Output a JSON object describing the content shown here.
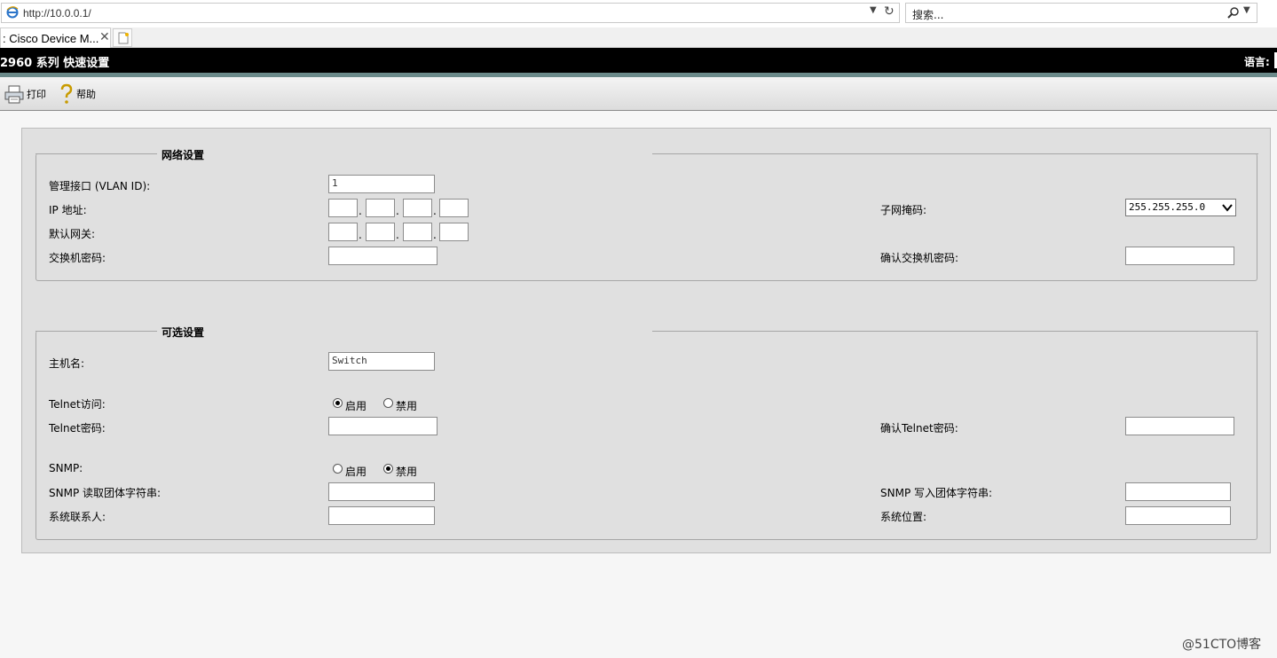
{
  "browser": {
    "address": "http://10.0.0.1/",
    "search_placeholder": "搜索...",
    "tab_title": ": Cisco Device M...",
    "tab_close": "✕"
  },
  "header": {
    "title": "2960 系列 快速设置",
    "language_label": "语言:"
  },
  "toolbar": {
    "print_label": "打印",
    "help_label": "帮助"
  },
  "network": {
    "legend": "网络设置",
    "mgmt_label": "管理接口 (VLAN ID):",
    "mgmt_value": "1",
    "ip_label": "IP 地址:",
    "subnet_label": "子网掩码:",
    "subnet_value": "255.255.255.0",
    "gateway_label": "默认网关:",
    "switch_pw_label": "交换机密码:",
    "confirm_switch_pw_label": "确认交换机密码:",
    "octet_dot": "."
  },
  "optional": {
    "legend": "可选设置",
    "hostname_label": "主机名:",
    "hostname_value": "Switch",
    "telnet_label": "Telnet访问:",
    "telnet_enable": "启用",
    "telnet_disable": "禁用",
    "telnet_pw_label": "Telnet密码:",
    "confirm_telnet_pw_label": "确认Telnet密码:",
    "snmp_label": "SNMP:",
    "snmp_enable": "启用",
    "snmp_disable": "禁用",
    "snmp_read_label": "SNMP 读取团体字符串:",
    "snmp_write_label": "SNMP 写入团体字符串:",
    "contact_label": "系统联系人:",
    "location_label": "系统位置:"
  },
  "watermark": "@51CTO博客",
  "colors": {
    "titlebar": "#000000",
    "accent_bar": "#6b8a8a",
    "panel": "#e0e0e0"
  }
}
